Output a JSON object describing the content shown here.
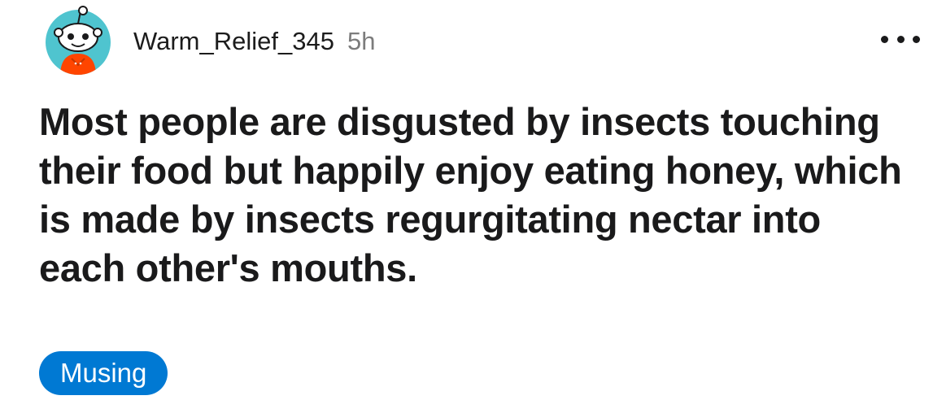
{
  "post": {
    "author": {
      "username": "Warm_Relief_345",
      "time_ago": "5h",
      "avatar_icon": "snoo-avatar-icon"
    },
    "title": "Most people are disgusted by insects touching their food but happily enjoy eating honey, which is made by insects regurgitating nectar into each other's mouths.",
    "flair": {
      "label": "Musing",
      "color": "#0079d3"
    },
    "more_icon": "ellipsis-horizontal-icon"
  },
  "colors": {
    "avatar_bg": "#4fc4cf",
    "avatar_body": "#ff4500",
    "text_primary": "#1a1a1b",
    "text_secondary": "#7c7c7c"
  }
}
